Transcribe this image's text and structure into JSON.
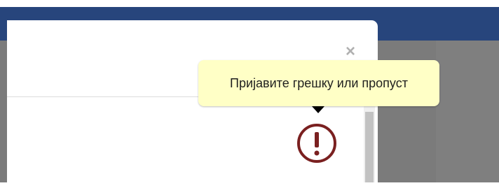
{
  "tooltip": {
    "text": "Пријавите грешку или пропуст"
  },
  "modal": {
    "close_label": "×"
  },
  "icons": {
    "close": "close-icon",
    "report": "exclamation-circle-icon"
  },
  "colors": {
    "header_blue": "#27457c",
    "overlay_gray": "#7b7b7b",
    "tooltip_bg": "#ffffc6",
    "report_icon": "#7a2020"
  }
}
